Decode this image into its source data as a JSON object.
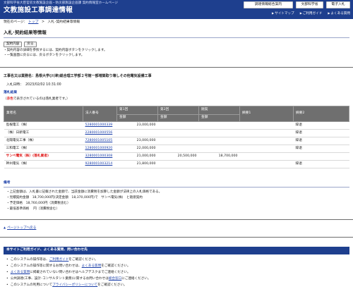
{
  "header": {
    "subtitle": "文部科学省大臣官房文教施設企画・防災部施設企画課 契約情報室ホームページ",
    "title": "文教施設工事調達情報",
    "buttons": [
      "調達情報総合案内",
      "文部科学省",
      "電子入札"
    ],
    "links": [
      "サイトマップ",
      "ご利用ガイド",
      "よくある質問"
    ]
  },
  "breadcrumb": {
    "prefix": "現在のページ：",
    "home": "トップ",
    "sep": ">",
    "current": "入札･契約結果等情報"
  },
  "page_title": "入札･契約結果等情報",
  "top_buttons": [
    "契約内容",
    "戻る"
  ],
  "notes": [
    "・契約内容の詳細を参照するには、契約内容ボタンをクリックします。",
    "・一覧画面に戻るには、戻るボタンをクリックします。"
  ],
  "project_name": "工事名又は業務名：島根大学(川津)総合理工学部２号館一部増築取り壊しその他電気設備工事",
  "bid_datetime_label": "入札日時：",
  "bid_datetime": "2023/02/02 10:31:00",
  "result_label": "落札結果",
  "legend": {
    "prefix": "（",
    "red_text": "赤色",
    "suffix": "で表示されているのは落札業者です。）"
  },
  "table": {
    "headers": {
      "company": "業者名",
      "corp_no": "法人番号",
      "round1": "第1回",
      "round2": "第2回",
      "negotiation": "随契",
      "note1": "摘要1",
      "note2": "摘要2",
      "amount": "金額"
    },
    "rows": [
      {
        "company": "島根電工（株）",
        "corp_no": "5280001000339",
        "r1": "23,000,000",
        "r2": "",
        "neg": "",
        "note1": "",
        "note2": "辞退",
        "winner": false
      },
      {
        "company": "（株）日新電工",
        "corp_no": "2280001000556",
        "r1": "",
        "r2": "",
        "neg": "",
        "note1": "",
        "note2": "辞退",
        "winner": false
      },
      {
        "company": "北陽電気工事（株）",
        "corp_no": "7280001005105",
        "r1": "23,000,000",
        "r2": "",
        "neg": "",
        "note1": "",
        "note2": "辞退",
        "winner": false
      },
      {
        "company": "三和電工（株）",
        "corp_no": "1280001000920",
        "r1": "22,000,000",
        "r2": "",
        "neg": "",
        "note1": "",
        "note2": "辞退",
        "winner": false
      },
      {
        "company": "サンベ電気（株）(落札業者)",
        "corp_no": "3280001000308",
        "r1": "21,000,000",
        "r2": "20,500,000",
        "neg": "18,700,000",
        "note1": "",
        "note2": "",
        "winner": true
      },
      {
        "company": "神州電気（株）",
        "corp_no": "9280001003214",
        "r1": "21,800,000",
        "r2": "",
        "neg": "",
        "note1": "",
        "note2": "辞退",
        "winner": false
      }
    ]
  },
  "remarks_label": "備考",
  "remarks": [
    "・上記金額は、入札書に記載された金額で、当該金額に消費税を加算した金額が法律上の入札価格である。",
    "・見積契約金額　18,700,000円(決定金額　18,370,000円)で　サンベ電気(株)　と随意契約",
    "・予定価格　18,760,000円（消費税含む）",
    "・最低基準価格　 円（消費税含む）"
  ],
  "back_to_top": "ページトップへ戻る",
  "guide": {
    "bar_title": "本サイトご利用ガイド、よくある質問、問い合わせ先",
    "items": [
      {
        "pre": "このシステムの操作等は、",
        "link": "ご利用ガイド",
        "post": "をご確認ください。"
      },
      {
        "pre": "このシステムの操作等に関するお問い合わせは、",
        "link": "よくある質問",
        "post": "をご確認ください。"
      },
      {
        "pre": "",
        "link": "よくある質問",
        "post": "に掲載されていない問い合わせはヘルプデスクまでご連絡ください。"
      },
      {
        "pre": "公共調達(工事、設計･コンサルタント業務)に関するお問い合わせは",
        "link": "総合窓口",
        "post": "にご連絡ください。"
      },
      {
        "pre": "このシステムの利用について",
        "link": "プライバシーポリシーについて",
        "post": "をご確認ください。"
      }
    ]
  }
}
